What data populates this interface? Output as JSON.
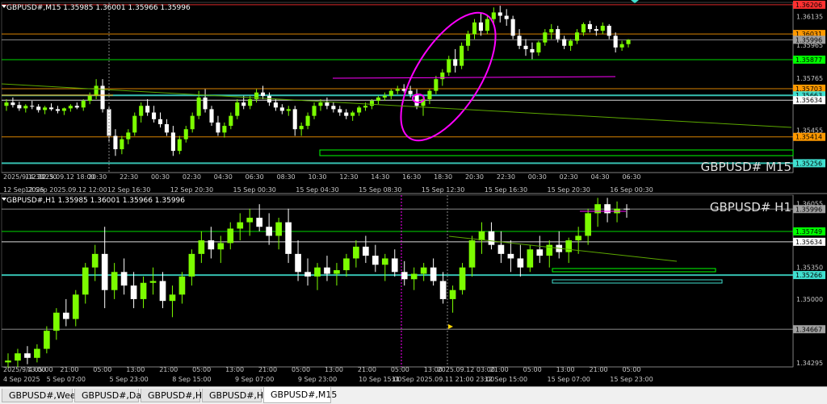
{
  "tabs": [
    {
      "label": "GBPUSD#,Weekly",
      "active": false
    },
    {
      "label": "GBPUSD#,Daily",
      "active": false
    },
    {
      "label": "GBPUSD#,H4",
      "active": false
    },
    {
      "label": "GBPUSD#,H1",
      "active": false
    },
    {
      "label": "GBPUSD#,M15",
      "active": true
    }
  ],
  "colors": {
    "bull": "#7CFC00",
    "bear": "#ffffff",
    "bg": "#000000",
    "grid": "#303030",
    "text": "#c8c8c8",
    "magenta": "#ff00ff",
    "orange": "#ff9900",
    "green_level": "#00ff00",
    "cyan": "#40e0d0",
    "violet": "#b070ff",
    "gray_line": "#b0b0b0"
  },
  "chart_data": [
    {
      "type": "candlestick",
      "header": "GBPUSD#,M15  1.35985 1.36001 1.35966 1.35996",
      "watermark": "GBPUSD#  M15",
      "ylim": [
        1.352,
        1.3622
      ],
      "price_ticks": [
        "1.36206",
        "1.36135",
        "1.35995",
        "1.35965",
        "1.35765",
        "1.35455",
        "1.35634"
      ],
      "level_labels": [
        {
          "text": "1.36206",
          "price": 1.36206,
          "color": "#ff3030"
        },
        {
          "text": "1.36031",
          "price": 1.36031,
          "color": "#ff9900"
        },
        {
          "text": "1.35996",
          "price": 1.35996,
          "color": "#a0a0a0"
        },
        {
          "text": "1.35877",
          "price": 1.35877,
          "color": "#00ff00"
        },
        {
          "text": "1.35703",
          "price": 1.35703,
          "color": "#ff9900"
        },
        {
          "text": "1.35663",
          "price": 1.35663,
          "color": "#40e0d0"
        },
        {
          "text": "1.35634",
          "price": 1.35634,
          "color": "#ffffff"
        },
        {
          "text": "1.35414",
          "price": 1.35414,
          "color": "#ff9900"
        },
        {
          "text": "1.35256",
          "price": 1.35256,
          "color": "#40e0d0"
        }
      ],
      "time_labels_top": [
        "2025/9/12 12:30",
        "14:30",
        "2025.09.12 18:00",
        "20:30",
        "22:30",
        "00:30",
        "02:30",
        "04:30",
        "06:30",
        "08:30",
        "10:30",
        "12:30",
        "14:30",
        "16:30",
        "18:30",
        "20:30",
        "22:30",
        "00:30",
        "02:30",
        "04:30",
        "06:30"
      ],
      "time_labels_bottom": [
        "12 Sep 2025",
        "12 Sep 2025.09.12 12:00",
        "12 Sep 16:30",
        "12 Sep 20:30",
        "15 Sep 00:30",
        "15 Sep 04:30",
        "15 Sep 08:30",
        "15 Sep 12:30",
        "15 Sep 16:30",
        "15 Sep 20:30",
        "16 Sep 00:30"
      ],
      "candles": [
        [
          1.356,
          1.3564,
          1.3557,
          1.3562
        ],
        [
          1.3562,
          1.3565,
          1.3559,
          1.35605
        ],
        [
          1.35605,
          1.35625,
          1.3557,
          1.35585
        ],
        [
          1.35585,
          1.3561,
          1.3556,
          1.356
        ],
        [
          1.356,
          1.3563,
          1.3558,
          1.35595
        ],
        [
          1.35595,
          1.3561,
          1.3556,
          1.35575
        ],
        [
          1.35575,
          1.356,
          1.3555,
          1.3559
        ],
        [
          1.3559,
          1.35615,
          1.3557,
          1.3558
        ],
        [
          1.3558,
          1.356,
          1.35555,
          1.3557
        ],
        [
          1.3557,
          1.3559,
          1.35545,
          1.35585
        ],
        [
          1.35585,
          1.3561,
          1.35565,
          1.356
        ],
        [
          1.356,
          1.3562,
          1.3558,
          1.3559
        ],
        [
          1.3559,
          1.3564,
          1.3557,
          1.3563
        ],
        [
          1.3563,
          1.3568,
          1.3561,
          1.3566
        ],
        [
          1.3566,
          1.3576,
          1.3564,
          1.3572
        ],
        [
          1.3572,
          1.3576,
          1.3556,
          1.3558
        ],
        [
          1.3558,
          1.356,
          1.3538,
          1.3542
        ],
        [
          1.3542,
          1.3546,
          1.353,
          1.3534
        ],
        [
          1.3534,
          1.3542,
          1.3531,
          1.354
        ],
        [
          1.354,
          1.3546,
          1.3537,
          1.3544
        ],
        [
          1.3544,
          1.3556,
          1.3542,
          1.3554
        ],
        [
          1.3554,
          1.3562,
          1.355,
          1.356
        ],
        [
          1.356,
          1.3564,
          1.3554,
          1.3556
        ],
        [
          1.3556,
          1.356,
          1.355,
          1.3552
        ],
        [
          1.3552,
          1.3556,
          1.3547,
          1.3549
        ],
        [
          1.3549,
          1.3552,
          1.3542,
          1.3544
        ],
        [
          1.3544,
          1.3548,
          1.353,
          1.3533
        ],
        [
          1.3533,
          1.3542,
          1.3531,
          1.354
        ],
        [
          1.354,
          1.3548,
          1.3538,
          1.3546
        ],
        [
          1.3546,
          1.3556,
          1.3544,
          1.3554
        ],
        [
          1.3554,
          1.3569,
          1.3552,
          1.3565
        ],
        [
          1.3565,
          1.357,
          1.3556,
          1.3558
        ],
        [
          1.3558,
          1.356,
          1.3548,
          1.355
        ],
        [
          1.355,
          1.3554,
          1.3542,
          1.3544
        ],
        [
          1.3544,
          1.355,
          1.3541,
          1.3548
        ],
        [
          1.3548,
          1.3556,
          1.3546,
          1.3554
        ],
        [
          1.3554,
          1.3564,
          1.3552,
          1.3562
        ],
        [
          1.3562,
          1.3566,
          1.3558,
          1.356
        ],
        [
          1.356,
          1.3566,
          1.3558,
          1.3564
        ],
        [
          1.3564,
          1.357,
          1.3562,
          1.3568
        ],
        [
          1.3568,
          1.3572,
          1.3564,
          1.3566
        ],
        [
          1.3566,
          1.3568,
          1.356,
          1.3562
        ],
        [
          1.3562,
          1.3564,
          1.3557,
          1.3559
        ],
        [
          1.3559,
          1.3561,
          1.3555,
          1.3557
        ],
        [
          1.3557,
          1.356,
          1.3554,
          1.3558
        ],
        [
          1.3558,
          1.356,
          1.3542,
          1.3546
        ],
        [
          1.3546,
          1.355,
          1.3542,
          1.3548
        ],
        [
          1.3548,
          1.3556,
          1.3546,
          1.3554
        ],
        [
          1.3554,
          1.3562,
          1.3552,
          1.356
        ],
        [
          1.356,
          1.3564,
          1.3557,
          1.3562
        ],
        [
          1.3562,
          1.3565,
          1.3558,
          1.356
        ],
        [
          1.356,
          1.3562,
          1.3556,
          1.3558
        ],
        [
          1.3558,
          1.356,
          1.3554,
          1.3556
        ],
        [
          1.3556,
          1.3558,
          1.3552,
          1.3554
        ],
        [
          1.3554,
          1.3557,
          1.3551,
          1.3556
        ],
        [
          1.3556,
          1.356,
          1.3554,
          1.3559
        ],
        [
          1.3559,
          1.3562,
          1.3557,
          1.356
        ],
        [
          1.356,
          1.3564,
          1.3558,
          1.3563
        ],
        [
          1.3563,
          1.3566,
          1.3561,
          1.3565
        ],
        [
          1.3565,
          1.3568,
          1.3563,
          1.3566
        ],
        [
          1.3566,
          1.357,
          1.3564,
          1.3569
        ],
        [
          1.3569,
          1.3572,
          1.3567,
          1.357
        ],
        [
          1.357,
          1.3573,
          1.3568,
          1.3569
        ],
        [
          1.3569,
          1.3572,
          1.3565,
          1.3567
        ],
        [
          1.3567,
          1.357,
          1.3558,
          1.356
        ],
        [
          1.356,
          1.3566,
          1.3554,
          1.3564
        ],
        [
          1.3564,
          1.357,
          1.3561,
          1.3569
        ],
        [
          1.3569,
          1.3578,
          1.3567,
          1.3576
        ],
        [
          1.3576,
          1.3582,
          1.3572,
          1.358
        ],
        [
          1.358,
          1.359,
          1.3578,
          1.3588
        ],
        [
          1.3588,
          1.3594,
          1.358,
          1.3584
        ],
        [
          1.3584,
          1.3598,
          1.3582,
          1.3596
        ],
        [
          1.3596,
          1.3605,
          1.3593,
          1.3603
        ],
        [
          1.3603,
          1.3612,
          1.36,
          1.361
        ],
        [
          1.361,
          1.3616,
          1.3602,
          1.3605
        ],
        [
          1.3605,
          1.3614,
          1.3603,
          1.3612
        ],
        [
          1.3612,
          1.3619,
          1.3609,
          1.3616
        ],
        [
          1.3616,
          1.362,
          1.361,
          1.3614
        ],
        [
          1.3614,
          1.3618,
          1.3608,
          1.3612
        ],
        [
          1.3612,
          1.3614,
          1.36,
          1.3602
        ],
        [
          1.3602,
          1.3606,
          1.3594,
          1.3596
        ],
        [
          1.3596,
          1.36,
          1.359,
          1.3594
        ],
        [
          1.3594,
          1.3598,
          1.3588,
          1.3592
        ],
        [
          1.3592,
          1.3599,
          1.359,
          1.3598
        ],
        [
          1.3598,
          1.3606,
          1.3596,
          1.3604
        ],
        [
          1.3604,
          1.3609,
          1.36,
          1.3606
        ],
        [
          1.3606,
          1.3608,
          1.3598,
          1.36
        ],
        [
          1.36,
          1.3602,
          1.3594,
          1.3596
        ],
        [
          1.3596,
          1.36,
          1.3593,
          1.3599
        ],
        [
          1.3599,
          1.3606,
          1.3597,
          1.3604
        ],
        [
          1.3604,
          1.361,
          1.3602,
          1.3609
        ],
        [
          1.3609,
          1.3611,
          1.3604,
          1.3606
        ],
        [
          1.3606,
          1.3608,
          1.3602,
          1.3605
        ],
        [
          1.3605,
          1.361,
          1.3603,
          1.3608
        ],
        [
          1.3608,
          1.3609,
          1.36,
          1.3602
        ],
        [
          1.3602,
          1.3604,
          1.3592,
          1.3595
        ],
        [
          1.3595,
          1.3599,
          1.3593,
          1.3597
        ],
        [
          1.3597,
          1.36,
          1.3595,
          1.35996
        ]
      ]
    },
    {
      "type": "candlestick",
      "header": "GBPUSD#,H1  1.35985 1.36001 1.35966 1.35996",
      "watermark": "GBPUSD#  H1",
      "ylim": [
        1.3425,
        1.3615
      ],
      "price_ticks": [
        "1.36055",
        "1.35350",
        "1.35000",
        "1.34667",
        "1.34295"
      ],
      "level_labels": [
        {
          "text": "1.35996",
          "price": 1.35996,
          "color": "#a0a0a0"
        },
        {
          "text": "1.35749",
          "price": 1.35749,
          "color": "#00ff00"
        },
        {
          "text": "1.35634",
          "price": 1.35634,
          "color": "#ffffff"
        },
        {
          "text": "1.35266",
          "price": 1.35266,
          "color": "#40e0d0"
        },
        {
          "text": "1.34667",
          "price": 1.34667,
          "color": "#a0a0a0"
        }
      ],
      "time_labels_top": [
        "2025/9/4 05:00",
        "13:00",
        "21:00",
        "05:00",
        "13:00",
        "21:00",
        "05:00",
        "13:00",
        "21:00",
        "05:00",
        "13:00",
        "21:00",
        "05:00",
        "13:00",
        "2025.09.12 03:00",
        "21:00",
        "05:00",
        "13:00",
        "21:00",
        "05:00"
      ],
      "time_labels_bottom": [
        "4 Sep 2025",
        "5 Sep 07:00",
        "5 Sep 23:00",
        "8 Sep 15:00",
        "9 Sep 07:00",
        "9 Sep 23:00",
        "10 Sep 15:00",
        "11 Sep 2025.09.11 21:00 23:00",
        "12 Sep 15:00",
        "15 Sep 07:00",
        "15 Sep 23:00"
      ],
      "candles": [
        [
          1.343,
          1.344,
          1.3424,
          1.3432
        ],
        [
          1.3432,
          1.3445,
          1.3425,
          1.344
        ],
        [
          1.344,
          1.3448,
          1.3428,
          1.3435
        ],
        [
          1.3435,
          1.345,
          1.343,
          1.3445
        ],
        [
          1.3445,
          1.347,
          1.344,
          1.3465
        ],
        [
          1.3465,
          1.349,
          1.3455,
          1.3485
        ],
        [
          1.3485,
          1.35,
          1.347,
          1.3478
        ],
        [
          1.3478,
          1.351,
          1.347,
          1.3505
        ],
        [
          1.3505,
          1.354,
          1.3495,
          1.3535
        ],
        [
          1.3535,
          1.356,
          1.352,
          1.355
        ],
        [
          1.355,
          1.358,
          1.349,
          1.351
        ],
        [
          1.351,
          1.354,
          1.35,
          1.353
        ],
        [
          1.353,
          1.3545,
          1.3505,
          1.3515
        ],
        [
          1.3515,
          1.353,
          1.349,
          1.35
        ],
        [
          1.35,
          1.3525,
          1.349,
          1.3518
        ],
        [
          1.3518,
          1.3535,
          1.3505,
          1.352
        ],
        [
          1.352,
          1.353,
          1.349,
          1.3498
        ],
        [
          1.3498,
          1.3515,
          1.348,
          1.3505
        ],
        [
          1.3505,
          1.353,
          1.3495,
          1.3525
        ],
        [
          1.3525,
          1.3555,
          1.3515,
          1.355
        ],
        [
          1.355,
          1.3575,
          1.354,
          1.3565
        ],
        [
          1.3565,
          1.358,
          1.3545,
          1.3555
        ],
        [
          1.3555,
          1.357,
          1.354,
          1.3562
        ],
        [
          1.3562,
          1.3585,
          1.3555,
          1.3578
        ],
        [
          1.3578,
          1.3595,
          1.3565,
          1.3585
        ],
        [
          1.3585,
          1.36,
          1.357,
          1.359
        ],
        [
          1.359,
          1.3605,
          1.3575,
          1.358
        ],
        [
          1.358,
          1.3595,
          1.356,
          1.357
        ],
        [
          1.357,
          1.359,
          1.3555,
          1.3585
        ],
        [
          1.3585,
          1.36,
          1.354,
          1.355
        ],
        [
          1.355,
          1.3565,
          1.352,
          1.353
        ],
        [
          1.353,
          1.3545,
          1.3515,
          1.3525
        ],
        [
          1.3525,
          1.354,
          1.351,
          1.3535
        ],
        [
          1.3535,
          1.3548,
          1.352,
          1.3528
        ],
        [
          1.3528,
          1.354,
          1.3515,
          1.3532
        ],
        [
          1.3532,
          1.355,
          1.3525,
          1.3545
        ],
        [
          1.3545,
          1.3565,
          1.3535,
          1.3558
        ],
        [
          1.3558,
          1.357,
          1.354,
          1.3548
        ],
        [
          1.3548,
          1.356,
          1.353,
          1.3538
        ],
        [
          1.3538,
          1.355,
          1.352,
          1.3545
        ],
        [
          1.3545,
          1.3555,
          1.3525,
          1.353
        ],
        [
          1.353,
          1.3542,
          1.3515,
          1.3522
        ],
        [
          1.3522,
          1.3535,
          1.351,
          1.3528
        ],
        [
          1.3528,
          1.354,
          1.352,
          1.3535
        ],
        [
          1.3535,
          1.3545,
          1.3515,
          1.352
        ],
        [
          1.352,
          1.353,
          1.3495,
          1.35
        ],
        [
          1.35,
          1.3515,
          1.3485,
          1.351
        ],
        [
          1.351,
          1.354,
          1.3505,
          1.3535
        ],
        [
          1.3535,
          1.357,
          1.3525,
          1.3565
        ],
        [
          1.3565,
          1.3585,
          1.355,
          1.3575
        ],
        [
          1.3575,
          1.3585,
          1.3555,
          1.356
        ],
        [
          1.356,
          1.3575,
          1.354,
          1.355
        ],
        [
          1.355,
          1.3565,
          1.353,
          1.3545
        ],
        [
          1.3545,
          1.356,
          1.3525,
          1.3535
        ],
        [
          1.3535,
          1.356,
          1.353,
          1.3555
        ],
        [
          1.3555,
          1.357,
          1.354,
          1.3548
        ],
        [
          1.3548,
          1.3565,
          1.3535,
          1.356
        ],
        [
          1.356,
          1.3575,
          1.3545,
          1.3552
        ],
        [
          1.3552,
          1.3568,
          1.354,
          1.3565
        ],
        [
          1.3565,
          1.358,
          1.355,
          1.357
        ],
        [
          1.357,
          1.36,
          1.356,
          1.3595
        ],
        [
          1.3595,
          1.3612,
          1.358,
          1.3605
        ],
        [
          1.3605,
          1.3612,
          1.3585,
          1.3595
        ],
        [
          1.3595,
          1.3608,
          1.3585,
          1.36
        ],
        [
          1.36,
          1.3605,
          1.359,
          1.35996
        ]
      ]
    }
  ]
}
